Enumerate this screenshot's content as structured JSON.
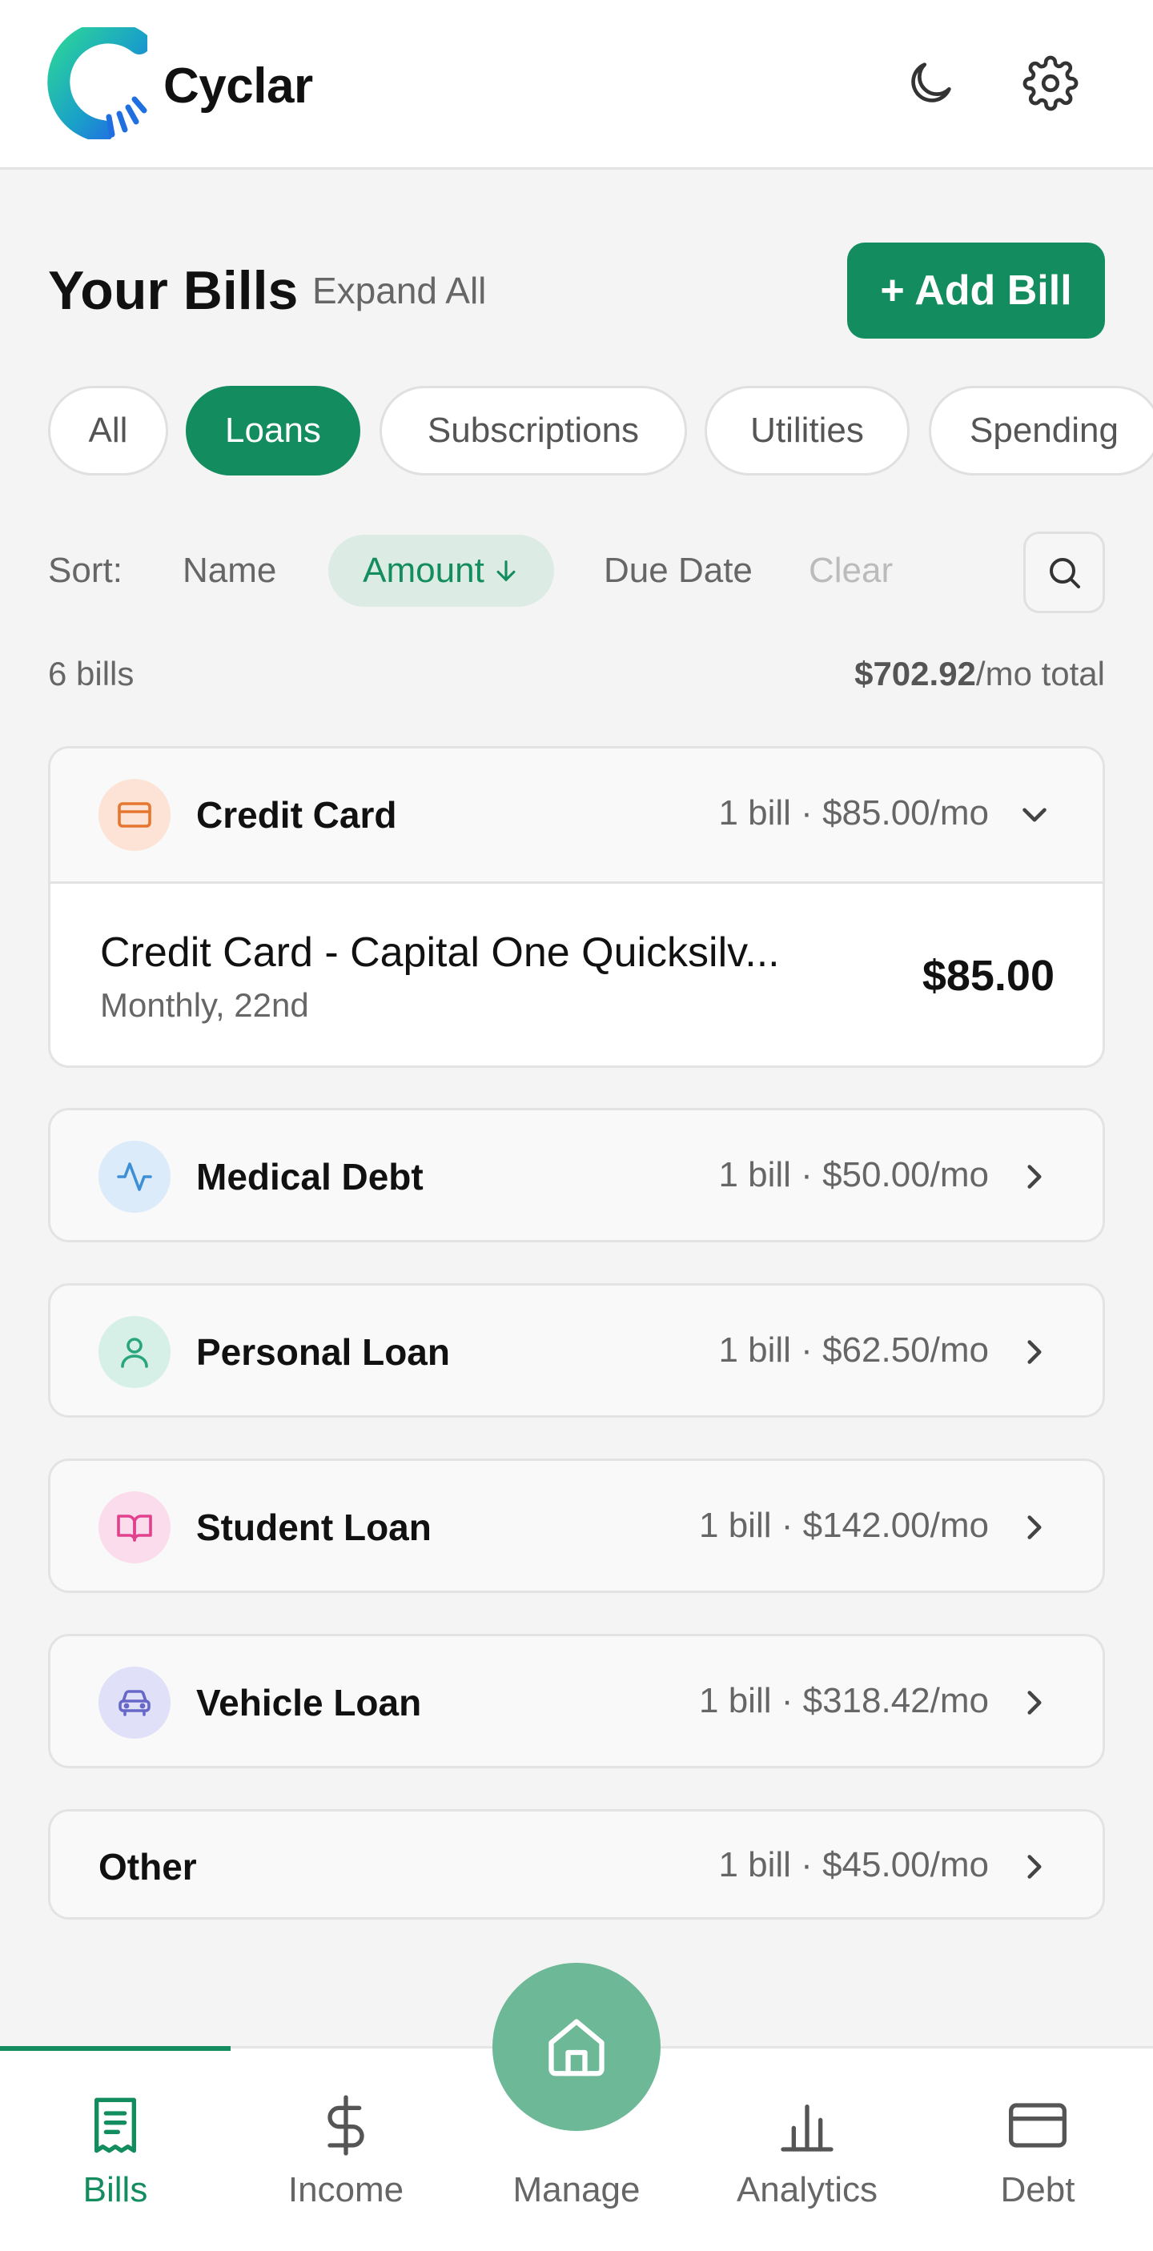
{
  "header": {
    "brand": "Cyclar",
    "theme_toggle_icon": "moon-icon",
    "settings_icon": "gear-icon"
  },
  "page": {
    "title": "Your Bills",
    "expand_all": "Expand All",
    "add_bill": "+ Add Bill"
  },
  "filters": [
    {
      "label": "All",
      "active": false
    },
    {
      "label": "Loans",
      "active": true
    },
    {
      "label": "Subscriptions",
      "active": false
    },
    {
      "label": "Utilities",
      "active": false
    },
    {
      "label": "Spending",
      "active": false
    }
  ],
  "sort": {
    "label": "Sort:",
    "options": [
      "Name",
      "Amount",
      "Due Date"
    ],
    "active": "Amount",
    "active_direction_icon": "arrow-down-icon",
    "clear": "Clear",
    "search_icon": "search-icon"
  },
  "summary": {
    "count": "6 bills",
    "total_amount": "$702.92",
    "total_suffix": "/mo total"
  },
  "groups": [
    {
      "name": "Credit Card",
      "meta": "1 bill · $85.00/mo",
      "icon": "credit-card-icon",
      "icon_bg": "#fde3d6",
      "icon_color": "#e6762f",
      "expanded": true,
      "bills": [
        {
          "name": "Credit Card - Capital One Quicksilv...",
          "schedule": "Monthly, 22nd",
          "amount": "$85.00"
        }
      ]
    },
    {
      "name": "Medical Debt",
      "meta": "1 bill · $50.00/mo",
      "icon": "activity-icon",
      "icon_bg": "#dcebfa",
      "icon_color": "#3e8fd6",
      "expanded": false
    },
    {
      "name": "Personal Loan",
      "meta": "1 bill · $62.50/mo",
      "icon": "user-icon",
      "icon_bg": "#d6f0e8",
      "icon_color": "#2aa57c",
      "expanded": false
    },
    {
      "name": "Student Loan",
      "meta": "1 bill · $142.00/mo",
      "icon": "book-icon",
      "icon_bg": "#fbdcec",
      "icon_color": "#e0428e",
      "expanded": false
    },
    {
      "name": "Vehicle Loan",
      "meta": "1 bill · $318.42/mo",
      "icon": "car-icon",
      "icon_bg": "#e0e0f8",
      "icon_color": "#6767c8",
      "expanded": false
    },
    {
      "name": "Other",
      "meta": "1 bill · $45.00/mo",
      "expanded": false
    }
  ],
  "bottom_nav": [
    {
      "label": "Bills",
      "icon": "receipt-icon",
      "active": true
    },
    {
      "label": "Income",
      "icon": "dollar-icon",
      "active": false
    },
    {
      "label": "Manage",
      "icon": "home-icon",
      "active": false
    },
    {
      "label": "Analytics",
      "icon": "bar-chart-icon",
      "active": false
    },
    {
      "label": "Debt",
      "icon": "credit-card-icon",
      "active": false
    }
  ],
  "colors": {
    "accent": "#138c5f",
    "accent_soft": "#dcece4",
    "fab": "#6db896"
  }
}
